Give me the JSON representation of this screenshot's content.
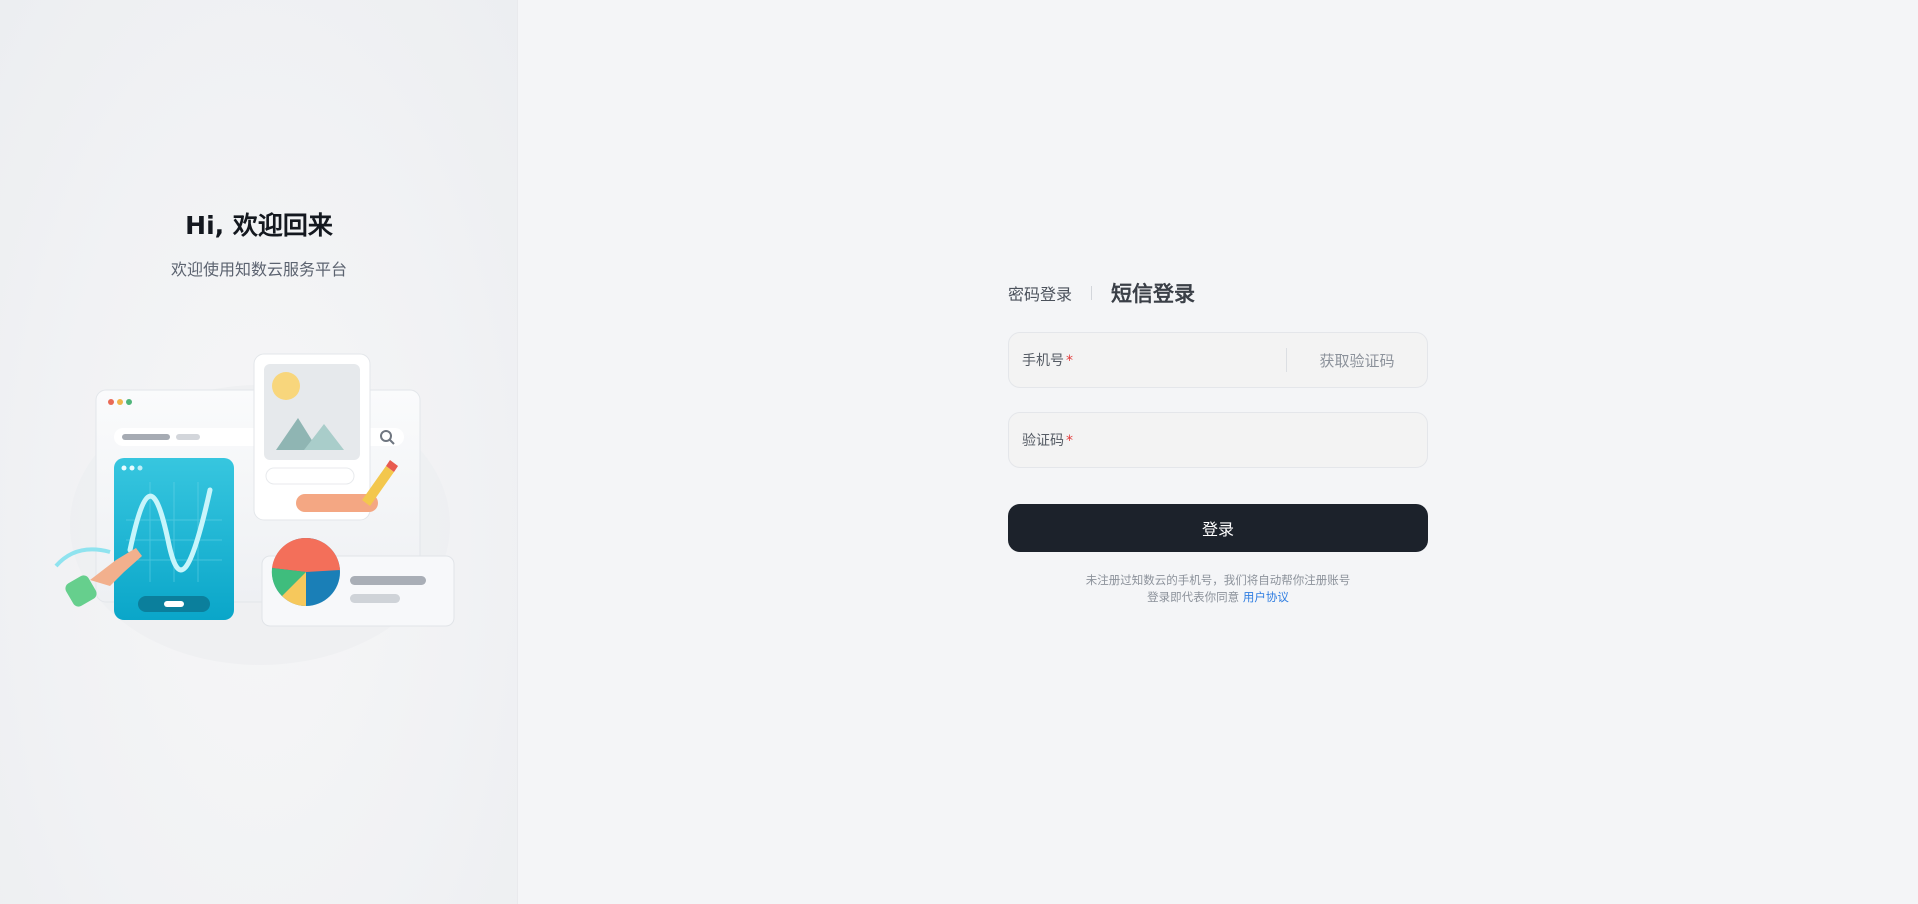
{
  "welcome": {
    "title": "Hi, 欢迎回来",
    "subtitle": "欢迎使用知数云服务平台"
  },
  "tabs": {
    "password_login": "密码登录",
    "sms_login": "短信登录",
    "active": "sms_login"
  },
  "phone_field": {
    "label": "手机号",
    "required_mark": "*",
    "value": "",
    "get_code_label": "获取验证码"
  },
  "code_field": {
    "label": "验证码",
    "required_mark": "*",
    "value": ""
  },
  "login_button": {
    "label": "登录"
  },
  "tips": {
    "line1": "未注册过知数云的手机号，我们将自动帮你注册账号",
    "line2": "登录即代表你同意",
    "agreement_link": "用户协议"
  },
  "colors": {
    "background": "#f4f5f7",
    "primary_button": "#1c222b",
    "link": "#2f7de1",
    "required": "#e23b3b"
  }
}
